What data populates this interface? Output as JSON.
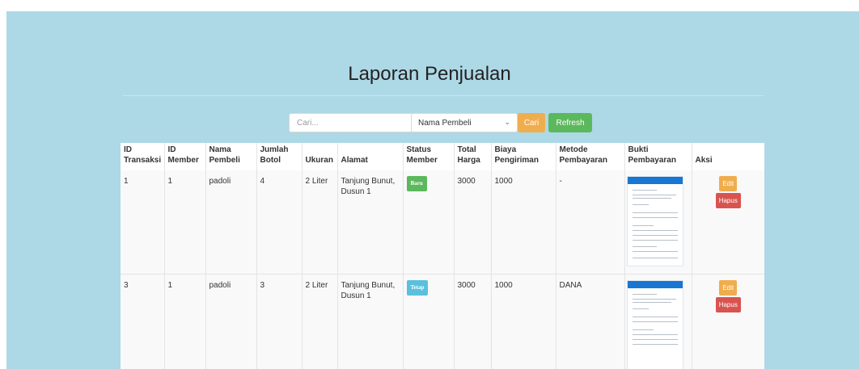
{
  "page": {
    "title": "Laporan Penjualan"
  },
  "search": {
    "placeholder": "Cari...",
    "filter_selected": "Nama Pembeli",
    "search_label": "Cari",
    "refresh_label": "Refresh"
  },
  "table": {
    "headers": {
      "id_transaksi": "ID Transaksi",
      "id_member": "ID Member",
      "nama_pembeli": "Nama Pembeli",
      "jumlah_botol": "Jumlah Botol",
      "ukuran": "Ukuran",
      "alamat": "Alamat",
      "status_member": "Status Member",
      "total_harga": "Total Harga",
      "biaya_pengiriman": "Biaya Pengiriman",
      "metode_pembayaran": "Metode Pembayaran",
      "bukti_pembayaran": "Bukti Pembayaran",
      "aksi": "Aksi"
    },
    "rows": [
      {
        "id_transaksi": "1",
        "id_member": "1",
        "nama_pembeli": "padoli",
        "jumlah_botol": "4",
        "ukuran": "2 Liter",
        "alamat": "Tanjung Bunut, Dusun 1",
        "status_member": "Baru",
        "total_harga": "3000",
        "biaya_pengiriman": "1000",
        "metode_pembayaran": "-",
        "edit_label": "Edit",
        "hapus_label": "Hapus"
      },
      {
        "id_transaksi": "3",
        "id_member": "1",
        "nama_pembeli": "padoli",
        "jumlah_botol": "3",
        "ukuran": "2 Liter",
        "alamat": "Tanjung Bunut, Dusun 1",
        "status_member": "Tetap",
        "total_harga": "3000",
        "biaya_pengiriman": "1000",
        "metode_pembayaran": "DANA",
        "edit_label": "Edit",
        "hapus_label": "Hapus"
      }
    ]
  },
  "colors": {
    "background": "#add8e6",
    "cari_button": "#f0ad4e",
    "refresh_button": "#5cb85c",
    "hapus_button": "#d9534f",
    "badge_baru": "#5cb85c",
    "badge_tetap": "#5bc0de"
  }
}
